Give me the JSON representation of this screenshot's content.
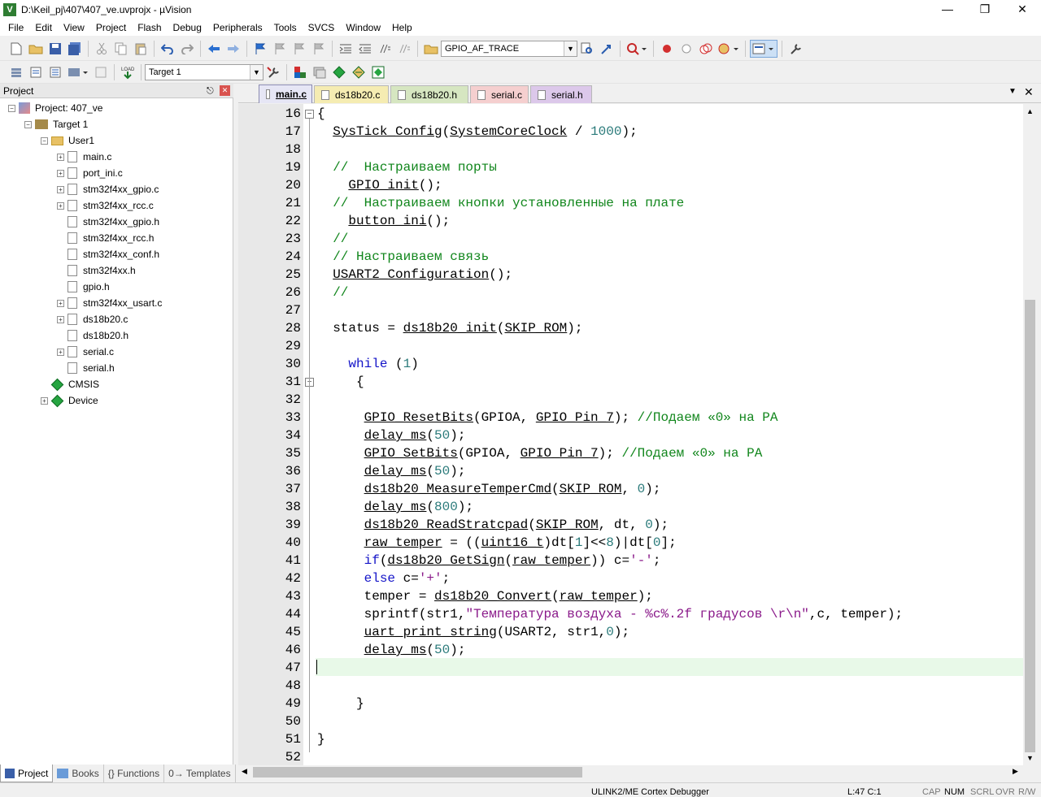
{
  "window": {
    "title": "D:\\Keil_pj\\407\\407_ve.uvprojx - µVision",
    "icon": "V"
  },
  "menu": [
    "File",
    "Edit",
    "View",
    "Project",
    "Flash",
    "Debug",
    "Peripherals",
    "Tools",
    "SVCS",
    "Window",
    "Help"
  ],
  "toolbar": {
    "find_combo": "GPIO_AF_TRACE",
    "target_combo": "Target 1"
  },
  "project_panel": {
    "title": "Project",
    "root": "Project: 407_ve",
    "target": "Target 1",
    "group": "User1",
    "files": [
      "main.c",
      "port_ini.c",
      "stm32f4xx_gpio.c",
      "stm32f4xx_rcc.c",
      "stm32f4xx_gpio.h",
      "stm32f4xx_rcc.h",
      "stm32f4xx_conf.h",
      "stm32f4xx.h",
      "gpio.h",
      "stm32f4xx_usart.c",
      "ds18b20.c",
      "ds18b20.h",
      "serial.c",
      "serial.h"
    ],
    "components": [
      "CMSIS",
      "Device"
    ]
  },
  "bottom_tabs": [
    "Project",
    "Books",
    "{} Functions",
    "0→ Templates"
  ],
  "editor_tabs": [
    {
      "label": "main.c",
      "color": "#e6e6f5"
    },
    {
      "label": "ds18b20.c",
      "color": "#f5ecb2"
    },
    {
      "label": "ds18b20.h",
      "color": "#d6e6c1"
    },
    {
      "label": "serial.c",
      "color": "#f5cfcf"
    },
    {
      "label": "serial.h",
      "color": "#dcc8ea"
    }
  ],
  "code_lines": [
    {
      "n": "16",
      "t": "{"
    },
    {
      "n": "17",
      "t": "  SysTick_Config(SystemCoreClock / 1000);"
    },
    {
      "n": "18",
      "t": ""
    },
    {
      "n": "19",
      "t": "  //  Настраиваем порты"
    },
    {
      "n": "20",
      "t": "    GPIO_init();"
    },
    {
      "n": "21",
      "t": "  //  Настраиваем кнопки установленные на плате"
    },
    {
      "n": "22",
      "t": "    button_ini();"
    },
    {
      "n": "23",
      "t": "  //"
    },
    {
      "n": "24",
      "t": "  // Настраиваем связь"
    },
    {
      "n": "25",
      "t": "  USART2_Configuration();"
    },
    {
      "n": "26",
      "t": "  //"
    },
    {
      "n": "27",
      "t": ""
    },
    {
      "n": "28",
      "t": "  status = ds18b20_init(SKIP_ROM);"
    },
    {
      "n": "29",
      "t": ""
    },
    {
      "n": "30",
      "t": "    while (1)"
    },
    {
      "n": "31",
      "t": "     {"
    },
    {
      "n": "32",
      "t": ""
    },
    {
      "n": "33",
      "t": "      GPIO_ResetBits(GPIOA, GPIO_Pin_7); //Подаем «0» на PA"
    },
    {
      "n": "34",
      "t": "      delay_ms(50);"
    },
    {
      "n": "35",
      "t": "      GPIO_SetBits(GPIOA, GPIO_Pin_7); //Подаем «0» на PA"
    },
    {
      "n": "36",
      "t": "      delay_ms(50);"
    },
    {
      "n": "37",
      "t": "      ds18b20_MeasureTemperCmd(SKIP_ROM, 0);"
    },
    {
      "n": "38",
      "t": "      delay_ms(800);"
    },
    {
      "n": "39",
      "t": "      ds18b20_ReadStratcpad(SKIP_ROM, dt, 0);"
    },
    {
      "n": "40",
      "t": "      raw_temper = ((uint16_t)dt[1]<<8)|dt[0];"
    },
    {
      "n": "41",
      "t": "      if(ds18b20_GetSign(raw_temper)) c='-';"
    },
    {
      "n": "42",
      "t": "      else c='+';"
    },
    {
      "n": "43",
      "t": "      temper = ds18b20_Convert(raw_temper);"
    },
    {
      "n": "44",
      "t": "      sprintf(str1,\"Температура воздуха - %c%.2f градусов \\r\\n\",c, temper);"
    },
    {
      "n": "45",
      "t": "      uart_print_string(USART2, str1,0);"
    },
    {
      "n": "46",
      "t": "      delay_ms(50);"
    },
    {
      "n": "47",
      "t": ""
    },
    {
      "n": "48",
      "t": ""
    },
    {
      "n": "49",
      "t": "     }"
    },
    {
      "n": "50",
      "t": ""
    },
    {
      "n": "51",
      "t": "}"
    },
    {
      "n": "52",
      "t": ""
    }
  ],
  "status_bar": {
    "debugger": "ULINK2/ME Cortex Debugger",
    "position": "L:47 C:1",
    "caps": "CAP",
    "num": "NUM",
    "scrl": "SCRL",
    "ovr": "OVR",
    "rw": "R/W"
  }
}
